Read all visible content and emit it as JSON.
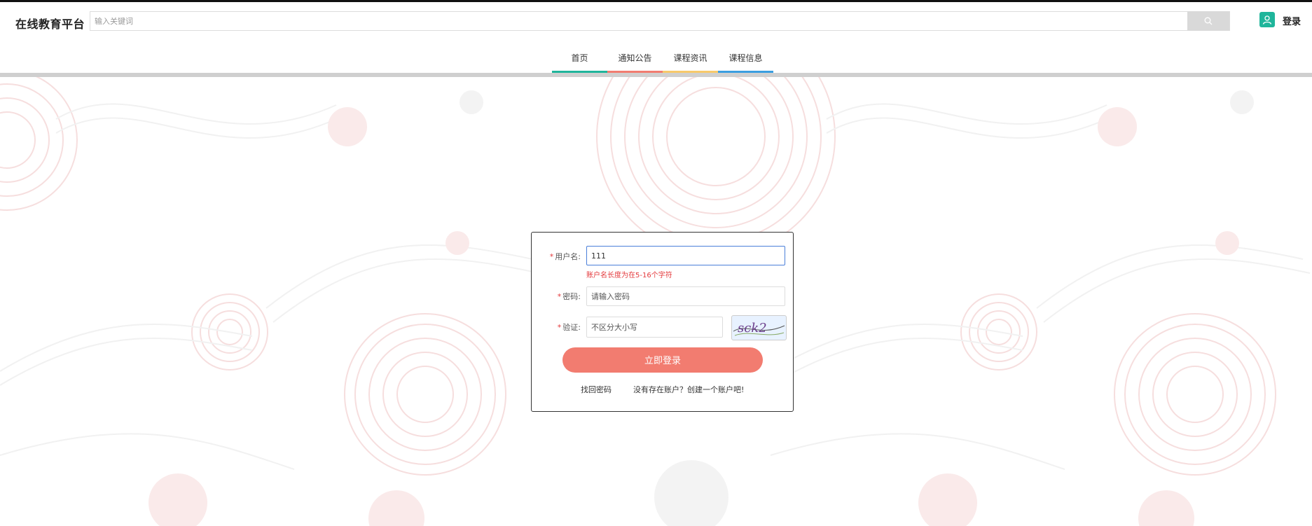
{
  "header": {
    "logo": "在线教育平台",
    "search_placeholder": "输入关键词",
    "login_label": "登录"
  },
  "nav": {
    "items": [
      {
        "label": "首页",
        "color": "#1fb59b"
      },
      {
        "label": "通知公告",
        "color": "#f27c70"
      },
      {
        "label": "课程资讯",
        "color": "#f7c96a"
      },
      {
        "label": "课程信息",
        "color": "#3a9ee0"
      }
    ]
  },
  "login": {
    "username_label": "用户名:",
    "username_value": "111",
    "username_error": "账户名长度为在5-16个字符",
    "password_label": "密码:",
    "password_placeholder": "请输入密码",
    "captcha_label": "验证:",
    "captcha_placeholder": "不区分大小写",
    "captcha_text": "sck2",
    "submit_label": "立即登录",
    "forgot_label": "找回密码",
    "register_label": "没有存在账户？创建一个账户吧!"
  },
  "colors": {
    "accent": "#f27c70",
    "brand": "#1fb59b"
  }
}
